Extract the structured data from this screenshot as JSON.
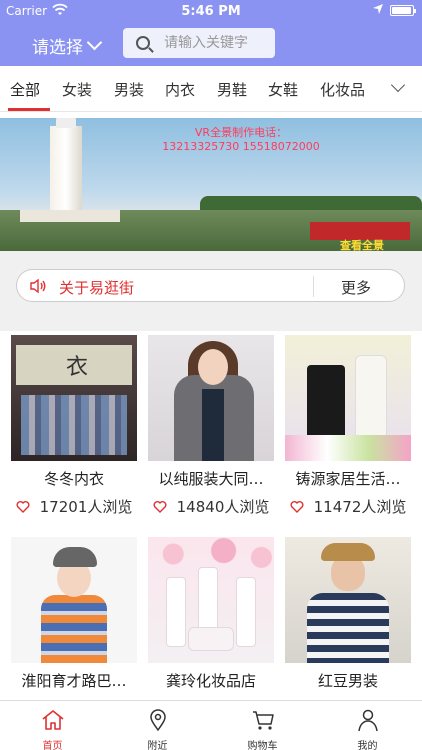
{
  "status_bar": {
    "carrier": "Carrier",
    "time": "5:46 PM"
  },
  "header": {
    "city_selector": "请选择",
    "search": {
      "placeholder": "请输入关键字"
    }
  },
  "categories": {
    "items": [
      "全部",
      "女装",
      "男装",
      "内衣",
      "男鞋",
      "女鞋",
      "化妆品"
    ],
    "active_index": 0
  },
  "banner": {
    "line1": "VR全景制作电话：",
    "line2": "13213325730 15518072000",
    "cta": "查看全景"
  },
  "notice": {
    "text": "关于易逛街",
    "more": "更多"
  },
  "shops": [
    {
      "name": "冬冬内衣",
      "views": "17201人浏览"
    },
    {
      "name": "以纯服装大同…",
      "views": "14840人浏览"
    },
    {
      "name": "铸源家居生活…",
      "views": "11472人浏览"
    },
    {
      "name": "淮阳育才路巴…",
      "views": ""
    },
    {
      "name": "龚玲化妆品店",
      "views": ""
    },
    {
      "name": "红豆男装",
      "views": ""
    }
  ],
  "tabbar": {
    "items": [
      {
        "label": "首页",
        "icon": "home-icon",
        "active": true
      },
      {
        "label": "附近",
        "icon": "location-pin-icon",
        "active": false
      },
      {
        "label": "购物车",
        "icon": "cart-icon",
        "active": false
      },
      {
        "label": "我的",
        "icon": "person-icon",
        "active": false
      }
    ]
  },
  "colors": {
    "header_bg": "#8a93f2",
    "accent_red": "#e03030",
    "notice_bg": "#f0f0f0"
  }
}
